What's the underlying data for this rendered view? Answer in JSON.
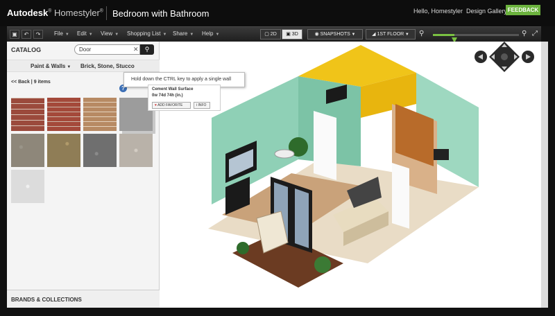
{
  "app": {
    "brand_main": "Autodesk",
    "brand_sub": "Homestyler",
    "brand_mark": "®",
    "project_title": "Bedroom with Bathroom",
    "greeting": "Hello, Homestyler",
    "gallery_link": "Design Gallery",
    "feedback_label": "FEEDBACK"
  },
  "menubar": {
    "menus": [
      {
        "label": "File"
      },
      {
        "label": "Edit"
      },
      {
        "label": "View"
      },
      {
        "label": "Shopping List"
      },
      {
        "label": "Share"
      },
      {
        "label": "Help"
      }
    ],
    "view_2d": "2D",
    "view_3d": "3D",
    "snapshots": "SNAPSHOTS",
    "floor": "1ST FLOOR",
    "zoom_level": 0.25
  },
  "catalog": {
    "header": "CATALOG",
    "search_value": "Door",
    "category": "Paint & Walls",
    "subcategory": "Brick, Stone, Stucco",
    "back_label": "<< Back | 9 items",
    "brands_label": "BRANDS & COLLECTIONS",
    "help_glyph": "?"
  },
  "tooltip": {
    "text": "Hold down the CTRL key to apply a single wall"
  },
  "popup": {
    "title": "Cement Wall Surface",
    "size": "0w 74d 74h (in.)",
    "favorite_label": "ADD FAVORITE",
    "info_label": "INFO"
  },
  "colors": {
    "accent_green": "#6cb33e",
    "wall_mint": "#8fd0b6",
    "wall_yellow": "#f0c419",
    "floor_wood": "#c9a27a"
  }
}
